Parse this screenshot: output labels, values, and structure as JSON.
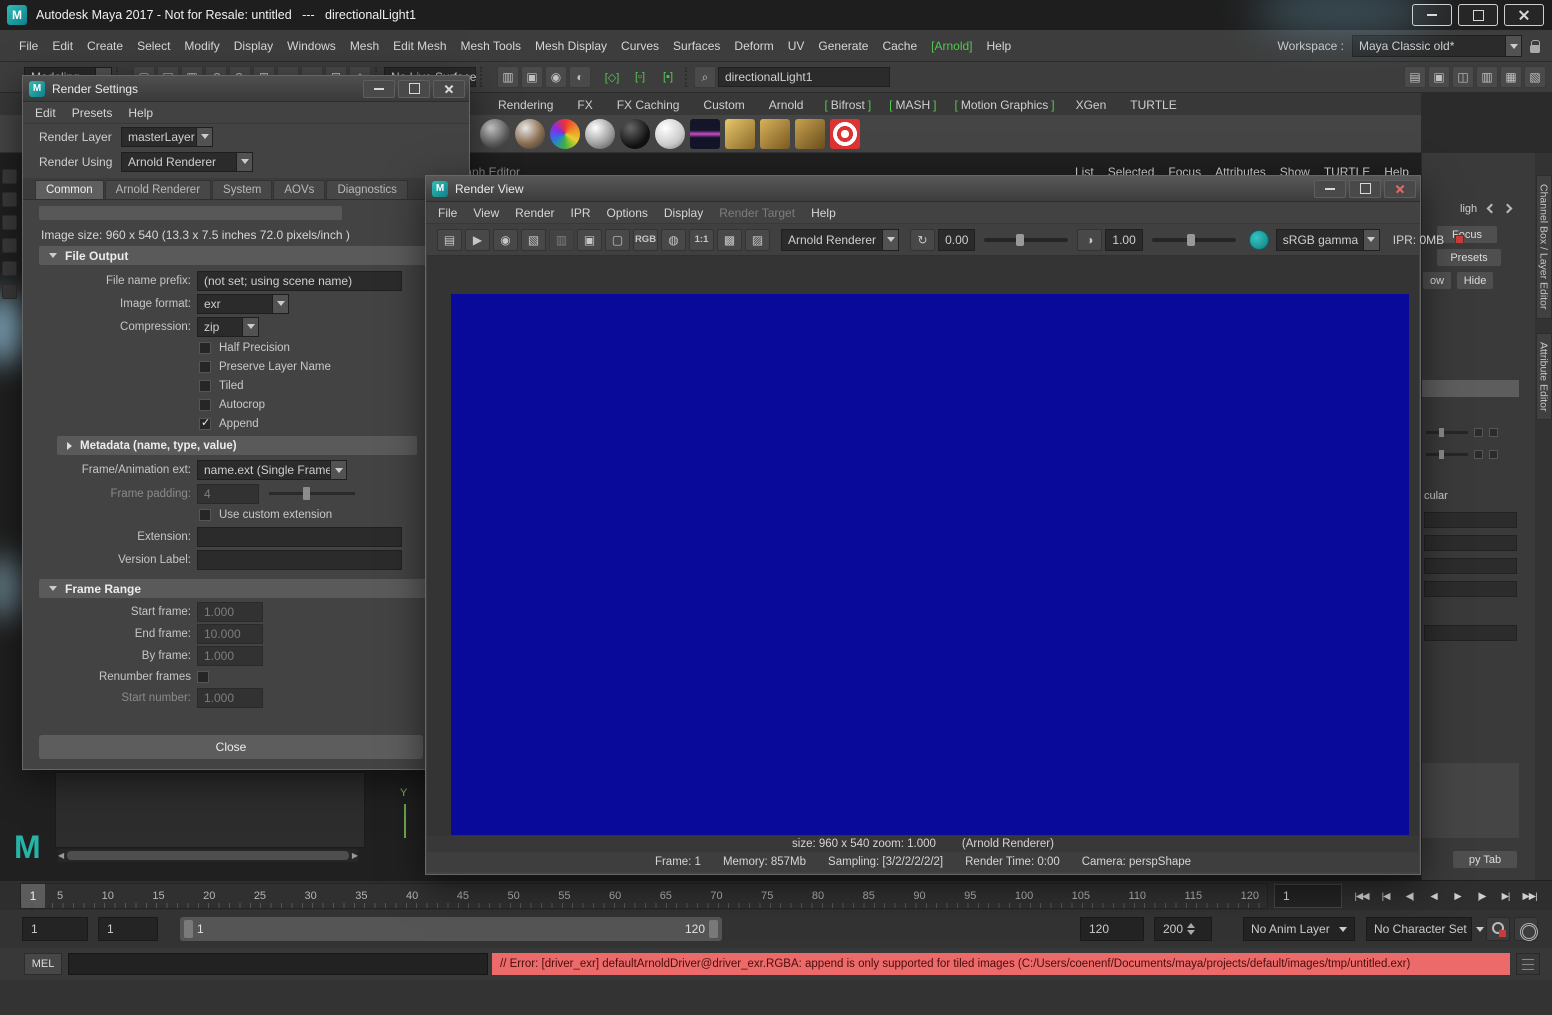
{
  "branding": {
    "logo_letter": "M"
  },
  "colors": {
    "accent_teal": "#25a8a0",
    "arnold_green": "#53c653",
    "render_image_blue": "#0a0a9a",
    "error_bg": "#ed6a6a"
  },
  "titlebar": {
    "title": "Autodesk Maya 2017 - Not for Resale: untitled   ---   directionalLight1"
  },
  "window_buttons": [
    {
      "name": "minimize-button",
      "cls": "wb-min"
    },
    {
      "name": "maximize-button",
      "cls": "wb-max"
    },
    {
      "name": "close-button",
      "cls": "wb-close"
    }
  ],
  "menubar": {
    "items": [
      {
        "label": "File"
      },
      {
        "label": "Edit"
      },
      {
        "label": "Create"
      },
      {
        "label": "Select"
      },
      {
        "label": "Modify"
      },
      {
        "label": "Display"
      },
      {
        "label": "Windows"
      },
      {
        "label": "Mesh"
      },
      {
        "label": "Edit Mesh"
      },
      {
        "label": "Mesh Tools"
      },
      {
        "label": "Mesh Display"
      },
      {
        "label": "Curves"
      },
      {
        "label": "Surfaces"
      },
      {
        "label": "Deform"
      },
      {
        "label": "UV"
      },
      {
        "label": "Generate"
      },
      {
        "label": "Cache"
      },
      {
        "label": "[Arnold]",
        "cls": "green",
        "name": "menu-item-arnold"
      },
      {
        "label": "Help"
      }
    ],
    "workspace_label": "Workspace :",
    "workspace_value": "Maya Classic old*"
  },
  "statusline": {
    "mode_selector": "Modeling",
    "left_icons": [
      {
        "name": "new-scene-icon",
        "glyph": "▢"
      },
      {
        "name": "open-scene-icon",
        "glyph": "▤"
      },
      {
        "name": "save-scene-icon",
        "glyph": "▦"
      },
      {
        "name": "undo-icon",
        "glyph": "↶"
      },
      {
        "name": "redo-icon",
        "glyph": "↷"
      },
      {
        "name": "snap-to-grid-icon",
        "glyph": "⊞"
      },
      {
        "name": "snap-to-curve-icon",
        "glyph": "◡"
      },
      {
        "name": "snap-to-point-icon",
        "glyph": "∙"
      },
      {
        "name": "snap-to-plane-icon",
        "glyph": "⊡"
      },
      {
        "name": "make-live-icon",
        "glyph": "◈"
      }
    ],
    "live_surface_value": "No Live Surface",
    "mid_icons": [
      {
        "name": "render-view-shortcut-icon",
        "glyph": "▥"
      },
      {
        "name": "render-current-frame-icon",
        "glyph": "▣"
      },
      {
        "name": "ipr-render-shortcut-icon",
        "glyph": "◉"
      },
      {
        "name": "render-settings-shortcut-icon",
        "glyph": "◐"
      }
    ],
    "bracket_icons": [
      {
        "name": "symmetry-toggle-icon",
        "glyph": "[◇]"
      },
      {
        "name": "highlight-selection-icon",
        "glyph": "[▫]"
      },
      {
        "name": "object-xray-icon",
        "glyph": "[▪]"
      }
    ],
    "selection_value": "directionalLight1",
    "right_icons": [
      {
        "name": "outliner-toggle-icon",
        "glyph": "▤"
      },
      {
        "name": "modeling-toolkit-icon",
        "glyph": "▣"
      },
      {
        "name": "character-controls-icon",
        "glyph": "◫"
      },
      {
        "name": "attribute-editor-toggle-icon",
        "glyph": "▥"
      },
      {
        "name": "tool-settings-toggle-icon",
        "glyph": "▦"
      },
      {
        "name": "channel-box-toggle-icon",
        "glyph": "▧"
      }
    ]
  },
  "shelf": {
    "tabs": [
      {
        "label": "Rendering"
      },
      {
        "label": "FX"
      },
      {
        "label": "FX Caching"
      },
      {
        "label": "Custom"
      },
      {
        "label": "Arnold"
      },
      {
        "pre": "[",
        "label": "Bifrost",
        "post": "]"
      },
      {
        "pre": "[",
        "label": "MASH",
        "post": "]"
      },
      {
        "pre": "[",
        "label": "Motion Graphics",
        "post": "]"
      },
      {
        "label": "XGen"
      },
      {
        "label": "TURTLE"
      }
    ],
    "icons": [
      {
        "name": "shader-ball-gray-icon",
        "cls": "ball b-gray"
      },
      {
        "name": "shader-ball-paint-icon",
        "cls": "ball b-paint"
      },
      {
        "name": "shader-ball-rainbow-icon",
        "cls": "ball b-rainbow"
      },
      {
        "name": "shader-ball-silver-icon",
        "cls": "ball b-silver"
      },
      {
        "name": "shader-ball-black-icon",
        "cls": "ball b-black"
      },
      {
        "name": "shader-ball-white-icon",
        "cls": "ball b-white"
      },
      {
        "name": "texture-icon",
        "cls": "sq s-tex"
      },
      {
        "name": "area-light-icon",
        "cls": "sq s-light1"
      },
      {
        "name": "skydome-light-icon",
        "cls": "sq s-light2"
      },
      {
        "name": "light-filter-icon",
        "cls": "sq s-light3"
      },
      {
        "name": "render-target-icon",
        "cls": "sq s-target"
      }
    ]
  },
  "background": {
    "graph_editor_label": "Graph Editor",
    "axis_label_y": "Y",
    "panel_menu_items": [
      {
        "label": "List"
      },
      {
        "label": "Selected"
      },
      {
        "label": "Focus"
      },
      {
        "label": "Attributes"
      },
      {
        "label": "Show"
      },
      {
        "label": "TURTLE"
      },
      {
        "label": "Help"
      }
    ]
  },
  "right_panel": {
    "vertical_tabs": [
      {
        "label": "Channel Box / Layer Editor"
      },
      {
        "label": "Attribute Editor"
      }
    ],
    "light_label_partial": "ligh",
    "focus_button": "Focus",
    "presets_button": "Presets",
    "show_button_partial": "ow",
    "hide_button": "Hide",
    "specular_label_partial": "cular",
    "copy_tab_button_partial": "py Tab"
  },
  "timeline": {
    "current_frame": "1",
    "ticks": [
      "5",
      "10",
      "15",
      "20",
      "25",
      "30",
      "35",
      "40",
      "45",
      "50",
      "55",
      "60",
      "65",
      "70",
      "75",
      "80",
      "85",
      "90",
      "95",
      "100",
      "105",
      "110",
      "115",
      "120"
    ],
    "current_time_value": "1",
    "transport": [
      {
        "name": "go-to-start-button",
        "glyph": "|◀◀"
      },
      {
        "name": "step-back-key-button",
        "glyph": "|◀"
      },
      {
        "name": "step-back-frame-button",
        "glyph": "◀|"
      },
      {
        "name": "play-backwards-button",
        "glyph": "◀"
      },
      {
        "name": "play-forwards-button",
        "glyph": "▶"
      },
      {
        "name": "step-forward-frame-button",
        "glyph": "|▶"
      },
      {
        "name": "step-forward-key-button",
        "glyph": "▶|"
      },
      {
        "name": "go-to-end-button",
        "glyph": "▶▶|"
      }
    ]
  },
  "range_bar": {
    "animation_start_value": "1",
    "playback_start_value": "1",
    "range_start_label": "1",
    "range_end_label": "120",
    "playback_end_value": "120",
    "animation_end_value": "200",
    "anim_layer_value": "No Anim Layer",
    "character_set_value": "No Character Set"
  },
  "command_line": {
    "mel_label": "MEL",
    "input_value": "",
    "error_text": "// Error: [driver_exr] defaultArnoldDriver@driver_exr.RGBA: append is only supported for tiled images (C:/Users/coenenf/Documents/maya/projects/default/images/tmp/untitled.exr)"
  },
  "render_settings": {
    "title": "Render Settings",
    "menus": [
      {
        "label": "Edit"
      },
      {
        "label": "Presets"
      },
      {
        "label": "Help"
      }
    ],
    "render_layer_label": "Render Layer",
    "render_layer_value": "masterLayer",
    "render_using_label": "Render Using",
    "render_using_value": "Arnold Renderer",
    "tabs": [
      {
        "label": "Common",
        "cls": "active"
      },
      {
        "label": "Arnold Renderer"
      },
      {
        "label": "System"
      },
      {
        "label": "AOVs"
      },
      {
        "label": "Diagnostics"
      }
    ],
    "image_size_info": "Image size: 960 x 540 (13.3 x 7.5 inches 72.0 pixels/inch )",
    "sections": {
      "file_output": "File Output",
      "metadata": "Metadata (name, type, value)",
      "frame_range": "Frame Range"
    },
    "fields": {
      "file_name_prefix_label": "File name prefix:",
      "file_name_prefix_value": "(not set; using scene name)",
      "image_format_label": "Image format:",
      "image_format_value": "exr",
      "compression_label": "Compression:",
      "compression_value": "zip",
      "frame_anim_ext_label": "Frame/Animation ext:",
      "frame_anim_ext_value": "name.ext (Single Frame)",
      "frame_padding_label": "Frame padding:",
      "frame_padding_value": "4",
      "use_custom_extension_label": "Use custom extension",
      "extension_label": "Extension:",
      "extension_value": "",
      "version_label_label": "Version Label:",
      "version_label_value": "",
      "start_frame_label": "Start frame:",
      "start_frame_value": "1.000",
      "end_frame_label": "End frame:",
      "end_frame_value": "10.000",
      "by_frame_label": "By frame:",
      "by_frame_value": "1.000",
      "renumber_frames_label": "Renumber frames",
      "start_number_label": "Start number:",
      "start_number_value": "1.000"
    },
    "checkboxes": [
      {
        "label": "Half Precision",
        "state": "unchecked"
      },
      {
        "label": "Preserve Layer Name",
        "state": "unchecked"
      },
      {
        "label": "Tiled",
        "state": "unchecked"
      },
      {
        "label": "Autocrop",
        "state": "unchecked"
      },
      {
        "label": "Append",
        "state": "checked"
      }
    ],
    "close_button": "Close"
  },
  "render_view": {
    "title": "Render View",
    "menus": [
      {
        "label": "File"
      },
      {
        "label": "View"
      },
      {
        "label": "Render"
      },
      {
        "label": "IPR"
      },
      {
        "label": "Options"
      },
      {
        "label": "Display"
      },
      {
        "label": "Render Target",
        "cls": "disabled",
        "name": "menu-item-render-target"
      },
      {
        "label": "Help"
      }
    ],
    "toolbar": {
      "icons": [
        {
          "name": "redo-render-icon",
          "glyph": "▤"
        },
        {
          "name": "ipr-render-icon",
          "glyph": "▶"
        },
        {
          "name": "snapshot-icon",
          "glyph": "◉"
        },
        {
          "name": "redo-region-icon",
          "glyph": "▧"
        },
        {
          "name": "ipr-region-icon",
          "glyph": "▥",
          "cls": "dim"
        },
        {
          "name": "keep-image-icon",
          "glyph": "▣"
        },
        {
          "name": "remove-image-icon",
          "glyph": "▢"
        },
        {
          "name": "display-rgb-icon",
          "glyph": "RGB",
          "cls": "txt"
        },
        {
          "name": "display-alpha-icon",
          "glyph": "◍"
        },
        {
          "name": "one-to-one-icon",
          "glyph": "1:1",
          "cls": "txt"
        },
        {
          "name": "open-image-icon",
          "glyph": "▩"
        },
        {
          "name": "save-image-icon",
          "glyph": "▨"
        }
      ],
      "renderer_value": "Arnold Renderer",
      "refresh_glyph": "↻",
      "exposure_value": "0.00",
      "contrast_glyph": "◑",
      "gamma_value": "1.00",
      "colorspace_value": "sRGB gamma",
      "ipr_memory": "IPR: 0MB"
    },
    "status_size_segments": [
      "size: 960 x 540 zoom: 1.000",
      "(Arnold Renderer)"
    ],
    "status_info_segments": [
      "Frame: 1",
      "Memory: 857Mb",
      "Sampling: [3/2/2/2/2/2]",
      "Render Time: 0:00",
      "Camera: perspShape"
    ]
  }
}
